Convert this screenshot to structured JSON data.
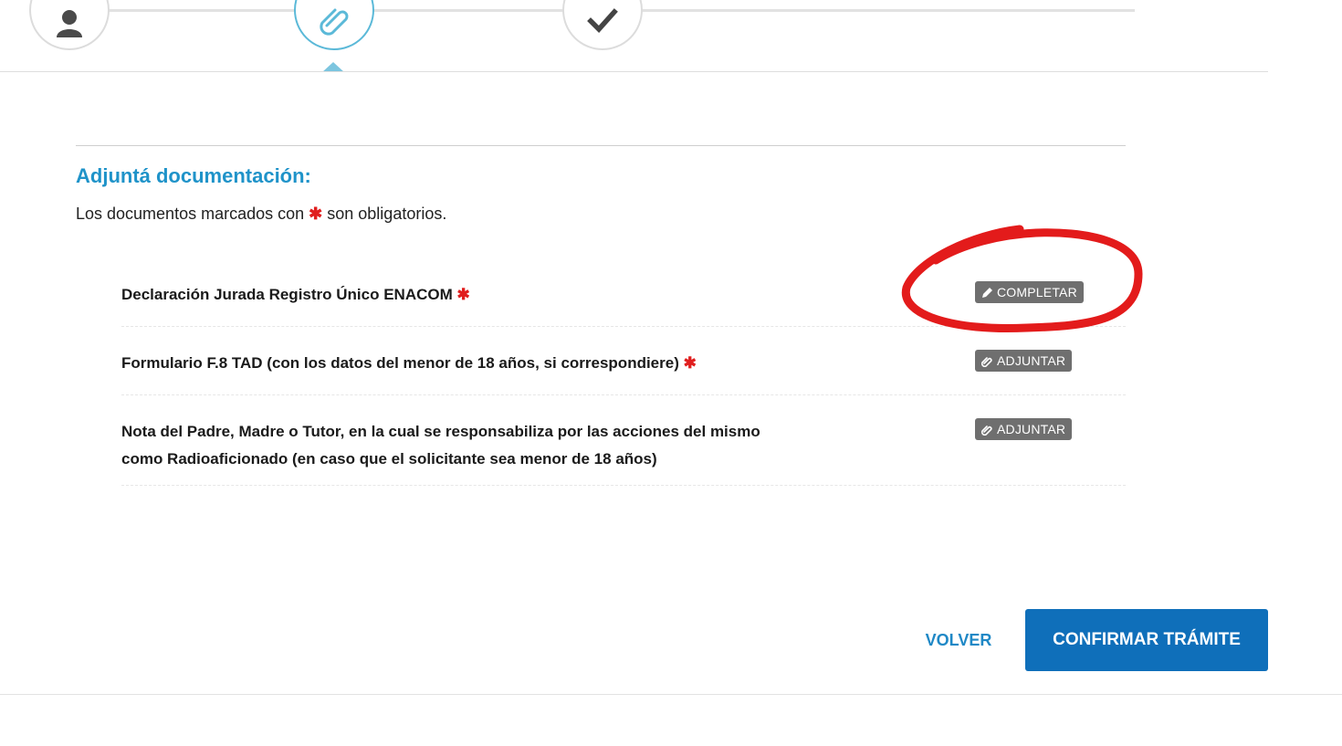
{
  "stepper": {
    "steps": [
      {
        "icon": "user-icon",
        "state": "done"
      },
      {
        "icon": "paperclip-icon",
        "state": "active"
      },
      {
        "icon": "checkmark-icon",
        "state": "pending"
      }
    ]
  },
  "section": {
    "title": "Adjuntá documentación:",
    "description_prefix": "Los documentos marcados con",
    "required_marker": "✱",
    "description_suffix": "son obligatorios."
  },
  "documents": [
    {
      "label": "Declaración Jurada Registro Único ENACOM",
      "required": true,
      "action": "COMPLETAR",
      "action_icon": "pencil-icon"
    },
    {
      "label": "Formulario F.8 TAD (con los datos del menor de 18 años, si correspondiere)",
      "required": true,
      "action": "ADJUNTAR",
      "action_icon": "paperclip-icon"
    },
    {
      "label": "Nota del Padre, Madre o Tutor, en la cual se responsabiliza por las acciones del mismo como Radioaficionado (en caso que el solicitante sea menor de 18 años)",
      "required": false,
      "action": "ADJUNTAR",
      "action_icon": "paperclip-icon"
    }
  ],
  "footer": {
    "back_label": "VOLVER",
    "confirm_label": "CONFIRMAR TRÁMITE"
  },
  "colors": {
    "accent": "#1f93c9",
    "primary_button": "#0f6fba",
    "required": "#e01e1e",
    "annotation": "#e31b1b"
  }
}
